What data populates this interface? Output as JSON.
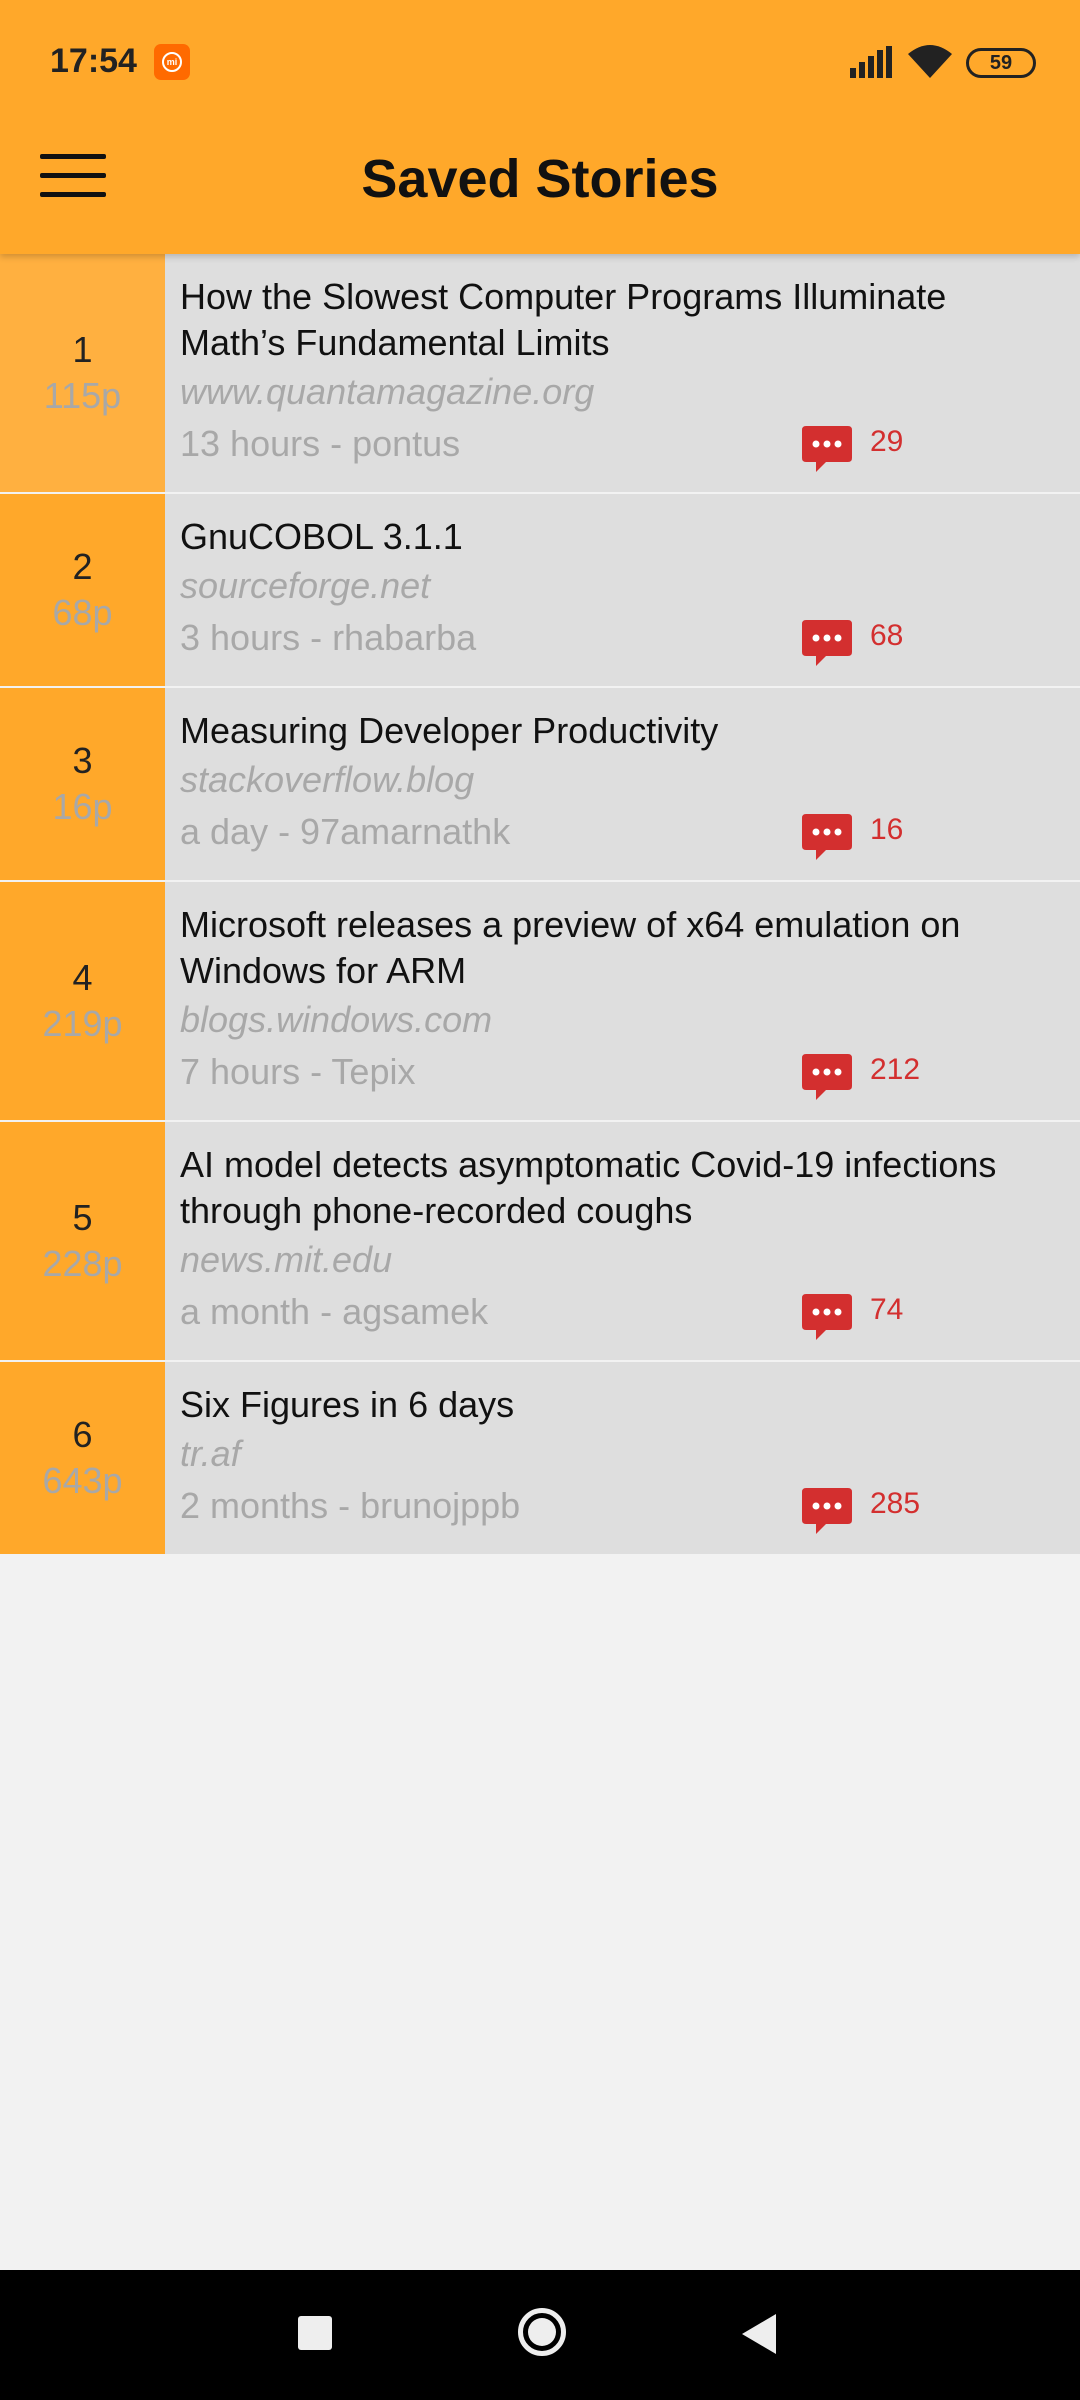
{
  "status_bar": {
    "time": "17:54",
    "battery": "59"
  },
  "header": {
    "title": "Saved Stories"
  },
  "stories": [
    {
      "rank": "1",
      "points": "115p",
      "title": "How the Slowest Computer Programs Illuminate Math’s Fundamental Limits",
      "domain": "www.quantamagazine.org",
      "meta": "13 hours -  pontus",
      "comments": "29"
    },
    {
      "rank": "2",
      "points": "68p",
      "title": "GnuCOBOL 3.1.1",
      "domain": "sourceforge.net",
      "meta": "3 hours -  rhabarba",
      "comments": "68"
    },
    {
      "rank": "3",
      "points": "16p",
      "title": "Measuring Developer Productivity",
      "domain": "stackoverflow.blog",
      "meta": "a day -  97amarnathk",
      "comments": "16"
    },
    {
      "rank": "4",
      "points": "219p",
      "title": "Microsoft releases a preview of x64 emulation on Windows for ARM",
      "domain": "blogs.windows.com",
      "meta": "7 hours -  Tepix",
      "comments": "212"
    },
    {
      "rank": "5",
      "points": "228p",
      "title": "AI model detects asymptomatic Covid-19 infections through phone-recorded coughs",
      "domain": "news.mit.edu",
      "meta": "a month -  agsamek",
      "comments": "74"
    },
    {
      "rank": "6",
      "points": "643p",
      "title": "Six Figures in 6 days",
      "domain": "tr.af",
      "meta": "2 months -  brunojppb",
      "comments": "285"
    }
  ],
  "colors": {
    "accent": "#ffa82a",
    "comment": "#d32f2f",
    "row_bg": "#dedede"
  }
}
